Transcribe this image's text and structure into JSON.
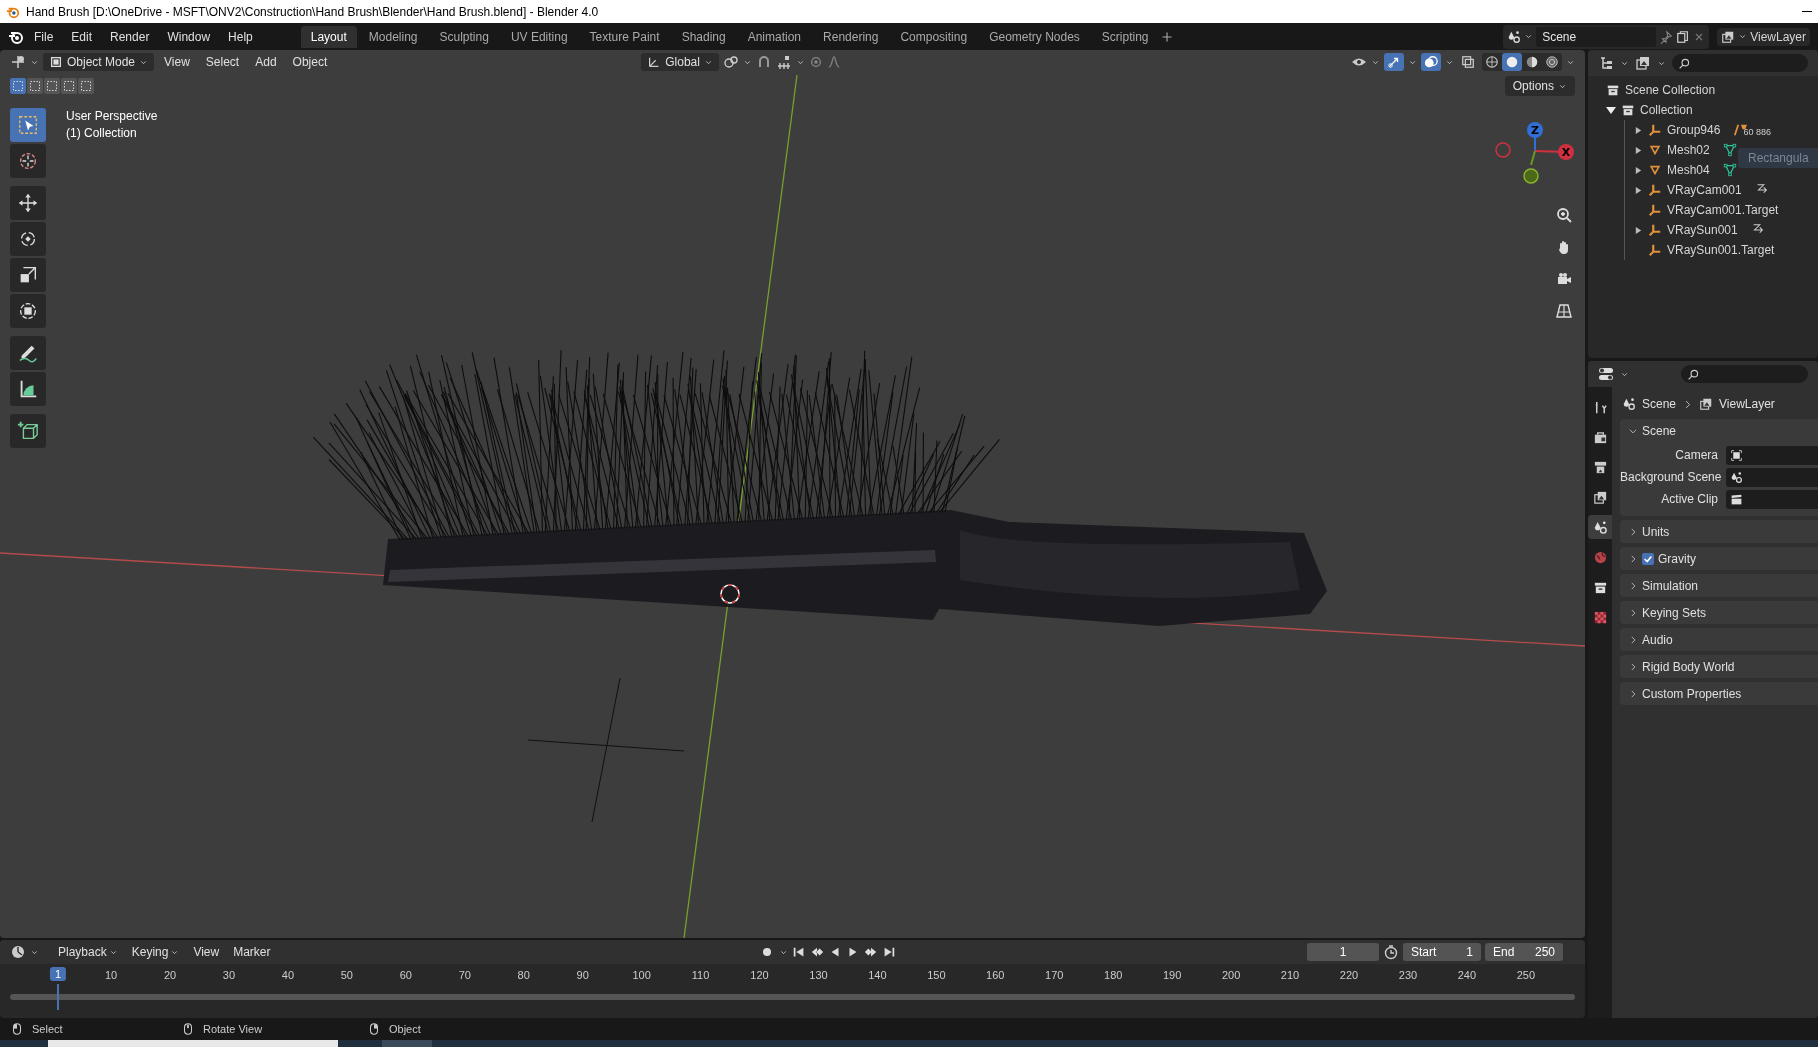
{
  "window": {
    "title": "Hand Brush [D:\\OneDrive - MSFT\\ONV2\\Construction\\Hand Brush\\Blender\\Hand Brush.blend] - Blender 4.0"
  },
  "menus": [
    "File",
    "Edit",
    "Render",
    "Window",
    "Help"
  ],
  "workspaces": [
    {
      "label": "Layout",
      "selected": true
    },
    {
      "label": "Modeling",
      "selected": false
    },
    {
      "label": "Sculpting",
      "selected": false
    },
    {
      "label": "UV Editing",
      "selected": false
    },
    {
      "label": "Texture Paint",
      "selected": false
    },
    {
      "label": "Shading",
      "selected": false
    },
    {
      "label": "Animation",
      "selected": false
    },
    {
      "label": "Rendering",
      "selected": false
    },
    {
      "label": "Compositing",
      "selected": false
    },
    {
      "label": "Geometry Nodes",
      "selected": false
    },
    {
      "label": "Scripting",
      "selected": false
    }
  ],
  "scene_selector": {
    "value": "Scene"
  },
  "view_layer_selector": {
    "value": "ViewLayer"
  },
  "viewport": {
    "mode": "Object Mode",
    "menus": [
      "View",
      "Select",
      "Add",
      "Object"
    ],
    "orientation": "Global",
    "options": "Options",
    "select_modes": [
      {
        "selected": true
      },
      {
        "selected": false
      },
      {
        "selected": false
      },
      {
        "selected": false
      },
      {
        "selected": false
      }
    ],
    "toggles": [
      {
        "kind": "gizmos",
        "on": true
      },
      {
        "kind": "overlays",
        "on": true
      },
      {
        "kind": "xray",
        "on": false
      }
    ],
    "shading": [
      {
        "kind": "wireframe",
        "selected": false
      },
      {
        "kind": "solid",
        "selected": true
      },
      {
        "kind": "material",
        "selected": false
      },
      {
        "kind": "rendered",
        "selected": false
      }
    ],
    "tools": [
      {
        "kind": "select",
        "selected": true
      },
      {
        "kind": "cursor",
        "selected": false
      },
      {
        "kind": "move",
        "selected": false
      },
      {
        "kind": "rotate",
        "selected": false
      },
      {
        "kind": "scale",
        "selected": false
      },
      {
        "kind": "transform",
        "selected": false
      },
      {
        "kind": "annotate",
        "selected": false
      },
      {
        "kind": "measure",
        "selected": false
      },
      {
        "kind": "add_cube",
        "selected": false
      }
    ],
    "info": [
      "User Perspective",
      "(1) Collection"
    ],
    "gizmo_axes": [
      "Z",
      "X"
    ]
  },
  "outliner": {
    "root": "Scene Collection",
    "drag_preview": "Rectangula",
    "items": [
      {
        "label": "Collection",
        "expanded": true,
        "children": [
          {
            "label": "Group946",
            "kind": "empty",
            "expanded": false,
            "extra": {
              "kind": "group",
              "count": "60 886"
            }
          },
          {
            "label": "Mesh02",
            "kind": "mesh",
            "expanded": false,
            "extra": {
              "kind": "mesh_data"
            }
          },
          {
            "label": "Mesh04",
            "kind": "mesh",
            "expanded": false,
            "extra": {
              "kind": "mesh_data"
            }
          },
          {
            "label": "VRayCam001",
            "kind": "empty",
            "expanded": false,
            "extra": {
              "kind": "constraint"
            }
          },
          {
            "label": "VRayCam001.Target",
            "kind": "empty"
          },
          {
            "label": "VRaySun001",
            "kind": "empty",
            "expanded": false,
            "extra": {
              "kind": "constraint"
            }
          },
          {
            "label": "VRaySun001.Target",
            "kind": "empty"
          }
        ]
      }
    ]
  },
  "properties": {
    "tabs": [
      {
        "kind": "tool",
        "selected": false
      },
      {
        "kind": "render",
        "selected": false
      },
      {
        "kind": "output",
        "selected": false
      },
      {
        "kind": "view_layer",
        "selected": false
      },
      {
        "kind": "scene",
        "selected": true
      },
      {
        "kind": "world",
        "selected": false
      },
      {
        "kind": "collection",
        "selected": false
      },
      {
        "kind": "texture",
        "selected": false
      }
    ],
    "breadcrumb": [
      "Scene",
      "ViewLayer"
    ],
    "panels": [
      {
        "title": "Scene",
        "expanded": true,
        "fields": [
          {
            "label": "Camera",
            "kind": "camera"
          },
          {
            "label": "Background Scene",
            "kind": "scene"
          },
          {
            "label": "Active Clip",
            "kind": "clip"
          }
        ]
      },
      {
        "title": "Units",
        "expanded": false
      },
      {
        "title": "Gravity",
        "expanded": false,
        "checked": true
      },
      {
        "title": "Simulation",
        "expanded": false
      },
      {
        "title": "Keying Sets",
        "expanded": false
      },
      {
        "title": "Audio",
        "expanded": false
      },
      {
        "title": "Rigid Body World",
        "expanded": false
      },
      {
        "title": "Custom Properties",
        "expanded": false
      }
    ]
  },
  "timeline": {
    "menus": [
      {
        "label": "Playback",
        "dropdown": true
      },
      {
        "label": "Keying",
        "dropdown": true
      },
      {
        "label": "View",
        "dropdown": false
      },
      {
        "label": "Marker",
        "dropdown": false
      }
    ],
    "current_frame": "1",
    "start_label": "Start",
    "start": "1",
    "end_label": "End",
    "end": "250",
    "playhead": "1",
    "ticks": [
      "10",
      "20",
      "30",
      "40",
      "50",
      "60",
      "70",
      "80",
      "90",
      "100",
      "110",
      "120",
      "130",
      "140",
      "150",
      "160",
      "170",
      "180",
      "190",
      "200",
      "210",
      "220",
      "230",
      "240",
      "250"
    ]
  },
  "status_bar": [
    "Select",
    "Rotate View",
    "Object"
  ]
}
